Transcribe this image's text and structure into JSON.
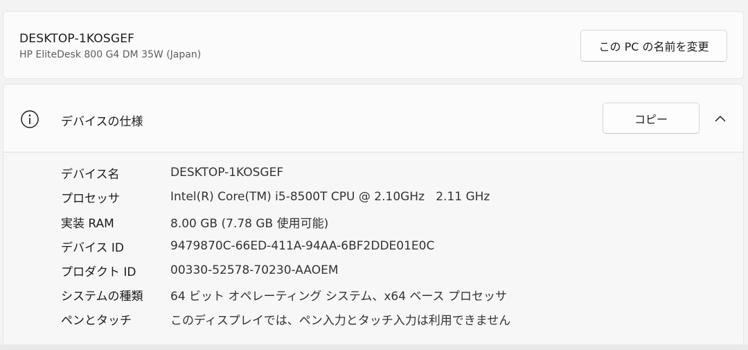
{
  "pc": {
    "name": "DESKTOP-1KOSGEF",
    "model": "HP EliteDesk 800 G4 DM 35W (Japan)",
    "rename_button": "この PC の名前を変更"
  },
  "device_specs": {
    "title": "デバイスの仕様",
    "copy_button": "コピー",
    "expanded": true,
    "rows": [
      {
        "label": "デバイス名",
        "value": "DESKTOP-1KOSGEF"
      },
      {
        "label": "プロセッサ",
        "value": "Intel(R) Core(TM) i5-8500T CPU @ 2.10GHz   2.11 GHz"
      },
      {
        "label": "実装 RAM",
        "value": "8.00 GB (7.78 GB 使用可能)"
      },
      {
        "label": "デバイス ID",
        "value": "9479870C-66ED-411A-94AA-6BF2DDE01E0C"
      },
      {
        "label": "プロダクト ID",
        "value": "00330-52578-70230-AAOEM"
      },
      {
        "label": "システムの種類",
        "value": "64 ビット オペレーティング システム、x64 ベース プロセッサ"
      },
      {
        "label": "ペンとタッチ",
        "value": "このディスプレイでは、ペン入力とタッチ入力は利用できません"
      }
    ]
  },
  "icons": {
    "info": "info-circle-icon",
    "collapse": "chevron-up-icon"
  }
}
